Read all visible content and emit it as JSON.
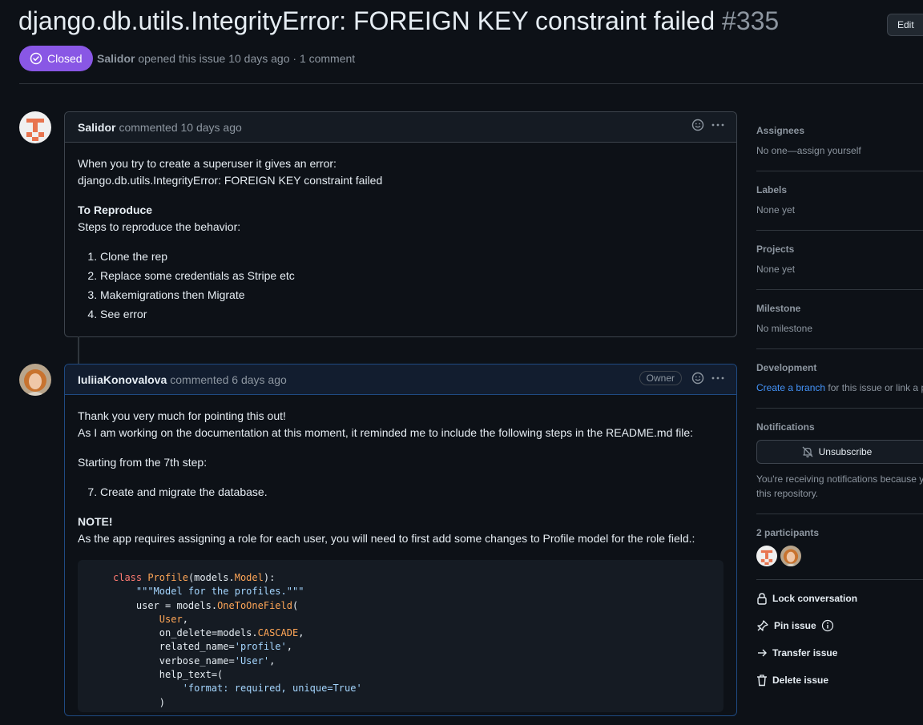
{
  "issue": {
    "title": "django.db.utils.IntegrityError: FOREIGN KEY constraint failed",
    "number": "#335",
    "state": "Closed",
    "author": "Salidor",
    "meta_rest": "opened this issue 10 days ago · 1 comment",
    "edit_label": "Edit"
  },
  "comments": [
    {
      "author": "Salidor",
      "time": "commented 10 days ago",
      "lines": [
        "When you try to create a superuser it gives an error:",
        "django.db.utils.IntegrityError: FOREIGN KEY constraint failed"
      ],
      "section_title": "To Reproduce",
      "section_text": "Steps to reproduce the behavior:",
      "steps": [
        "Clone the rep",
        "Replace some credentials as Stripe etc",
        "Makemigrations then Migrate",
        "See error"
      ]
    },
    {
      "author": "IuliiaKonovalova",
      "time": "commented 6 days ago",
      "badge": "Owner",
      "lines": [
        "Thank you very much for pointing this out!",
        "As I am working on the documentation at this moment, it reminded me to include the following steps in the README.md file:"
      ],
      "starting": "Starting from the 7th step:",
      "step": "Create and migrate the database.",
      "note_title": "NOTE!",
      "note_text": "As the app requires assigning a role for each user, you will need to first add some changes to Profile model for the role field.:",
      "code": {
        "l1_kw": "class",
        "l1_cls": "Profile",
        "l1_a": "(models.",
        "l1_b": "Model",
        "l1_c": "):",
        "l2": "\"\"\"Model for the profiles.\"\"\"",
        "l3_a": "user = models.",
        "l3_b": "OneToOneField",
        "l3_c": "(",
        "l4": "User",
        "l4_c": ",",
        "l5_a": "on_delete=models.",
        "l5_b": "CASCADE",
        "l5_c": ",",
        "l6_a": "related_name=",
        "l6_b": "'profile'",
        "l6_c": ",",
        "l7_a": "verbose_name=",
        "l7_b": "'User'",
        "l7_c": ",",
        "l8": "help_text=(",
        "l9": "'format: required, unique=True'",
        "l10": ")"
      }
    }
  ],
  "sidebar": {
    "assignees": {
      "heading": "Assignees",
      "text": "No one—assign yourself"
    },
    "labels": {
      "heading": "Labels",
      "text": "None yet"
    },
    "projects": {
      "heading": "Projects",
      "text": "None yet"
    },
    "milestone": {
      "heading": "Milestone",
      "text": "No milestone"
    },
    "development": {
      "heading": "Development",
      "link": "Create a branch",
      "text": " for this issue or link a p"
    },
    "notifications": {
      "heading": "Notifications",
      "button": "Unsubscribe",
      "text": "You're receiving notifications because y",
      "text2": "this repository."
    },
    "participants": {
      "heading": "2 participants"
    },
    "actions": {
      "lock": "Lock conversation",
      "pin": "Pin issue",
      "transfer": "Transfer issue",
      "delete": "Delete issue"
    }
  },
  "colors": {
    "closed": "#8957e5",
    "link": "#4493f8",
    "background": "#0d1117"
  }
}
